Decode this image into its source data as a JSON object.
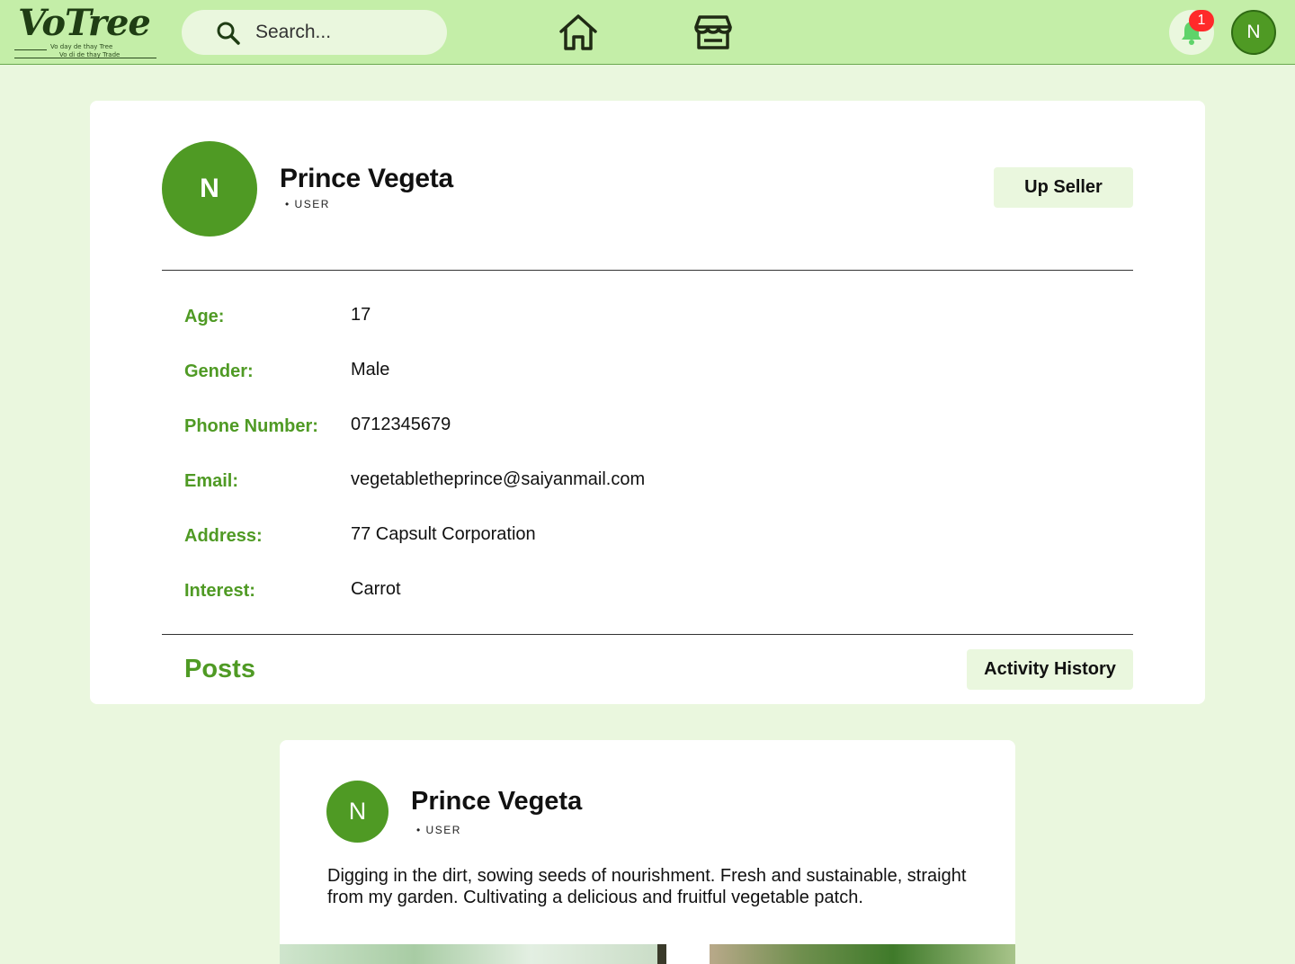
{
  "app": {
    "logo_text": "VoTree",
    "logo_tagline_1": "Vo day de thay Tree",
    "logo_tagline_2": "Vo di de thay Trade"
  },
  "topbar": {
    "search_placeholder": "Search...",
    "notification_count": "1",
    "user_initial": "N",
    "icons": [
      "search-icon",
      "home-icon",
      "store-icon",
      "bell-icon"
    ]
  },
  "profile": {
    "initial": "N",
    "name": "Prince Vegeta",
    "role": "• USER",
    "up_seller_label": "Up Seller",
    "fields": [
      {
        "label": "Age:",
        "value": "17"
      },
      {
        "label": "Gender:",
        "value": "Male"
      },
      {
        "label": "Phone Number:",
        "value": "0712345679"
      },
      {
        "label": "Email:",
        "value": "vegetabletheprince@saiyanmail.com"
      },
      {
        "label": "Address:",
        "value": "77 Capsult Corporation"
      },
      {
        "label": "Interest:",
        "value": "Carrot"
      }
    ],
    "posts_title": "Posts",
    "activity_history_label": "Activity History"
  },
  "post": {
    "initial": "N",
    "author": "Prince Vegeta",
    "role": "• USER",
    "text": "Digging in the dirt, sowing seeds of nourishment. Fresh and sustainable, straight from my garden. Cultivating a delicious and fruitful vegetable patch."
  },
  "colors": {
    "topbar_bg": "#c4eea8",
    "page_bg": "#eaf7de",
    "accent_green": "#4f9a24",
    "badge_red": "#ff2a2a"
  }
}
